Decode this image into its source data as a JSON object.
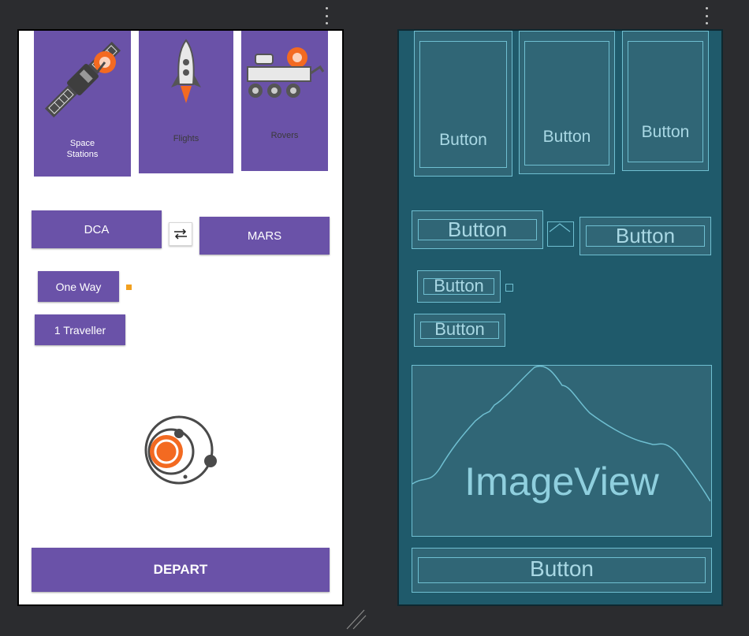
{
  "design_view": {
    "cards": [
      {
        "label": "Space\nStations",
        "icon": "satellite-icon"
      },
      {
        "label": "Flights",
        "icon": "rocket-icon"
      },
      {
        "label": "Rovers",
        "icon": "rover-icon"
      }
    ],
    "from_button": "DCA",
    "to_button": "MARS",
    "swap_icon": "swap-arrows-icon",
    "trip_type_button": "One Way",
    "travellers_button": "1 Traveller",
    "logo_icon": "planet-orbit-icon",
    "depart_button": "DEPART",
    "colors": {
      "primary": "#6a52a8",
      "accent": "#f36a21",
      "indicator": "#f2a01f"
    }
  },
  "blueprint_view": {
    "button_label": "Button",
    "image_view_label": "ImageView",
    "colors": {
      "background": "#1f5a6b",
      "outline": "#6fbfd1"
    }
  }
}
